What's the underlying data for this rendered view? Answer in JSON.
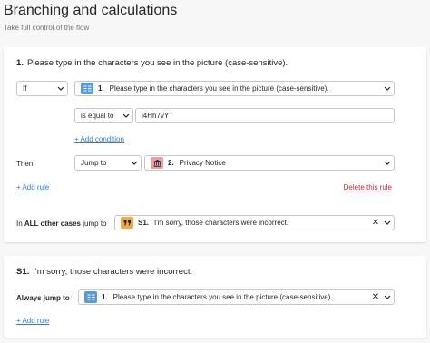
{
  "page": {
    "title": "Branching and calculations",
    "subtitle": "Take full control of the flow"
  },
  "rule_card": {
    "question_num": "1.",
    "question_text": "Please type in the characters you see in the picture (case-sensitive).",
    "if_label": "If",
    "if_field": {
      "num": "1.",
      "text": "Please type in the characters you see in the picture (case-sensitive).",
      "icon": "text-input-icon",
      "icon_color": "#5b9ad9"
    },
    "operator": "is equal to",
    "value": "i4Hh7vY",
    "add_condition": "+ Add condition",
    "then_label": "Then",
    "action": "Jump to",
    "target": {
      "num": "2.",
      "text": "Privacy Notice",
      "icon": "statement-icon",
      "icon_color": "#e8a0a4"
    },
    "add_rule": "+ Add rule",
    "delete_rule": "Delete this rule",
    "other_prefix": "In",
    "other_bold": "ALL other cases",
    "other_suffix": "jump to",
    "other_target": {
      "num": "S1.",
      "text": "I'm sorry, those characters were incorrect.",
      "icon": "quote-icon",
      "icon_color": "#f0a848"
    }
  },
  "statement_card": {
    "num": "S1.",
    "text": "I'm sorry, those characters were incorrect.",
    "always_label": "Always jump to",
    "target": {
      "num": "1.",
      "text": "Please type in the characters you see in the picture (case-sensitive).",
      "icon": "text-input-icon",
      "icon_color": "#5b9ad9"
    },
    "add_rule": "+ Add rule"
  },
  "colors": {
    "link": "#3b7bbf",
    "danger": "#c4263b",
    "border": "#c6c6c6",
    "background": "#f7f7f7"
  }
}
